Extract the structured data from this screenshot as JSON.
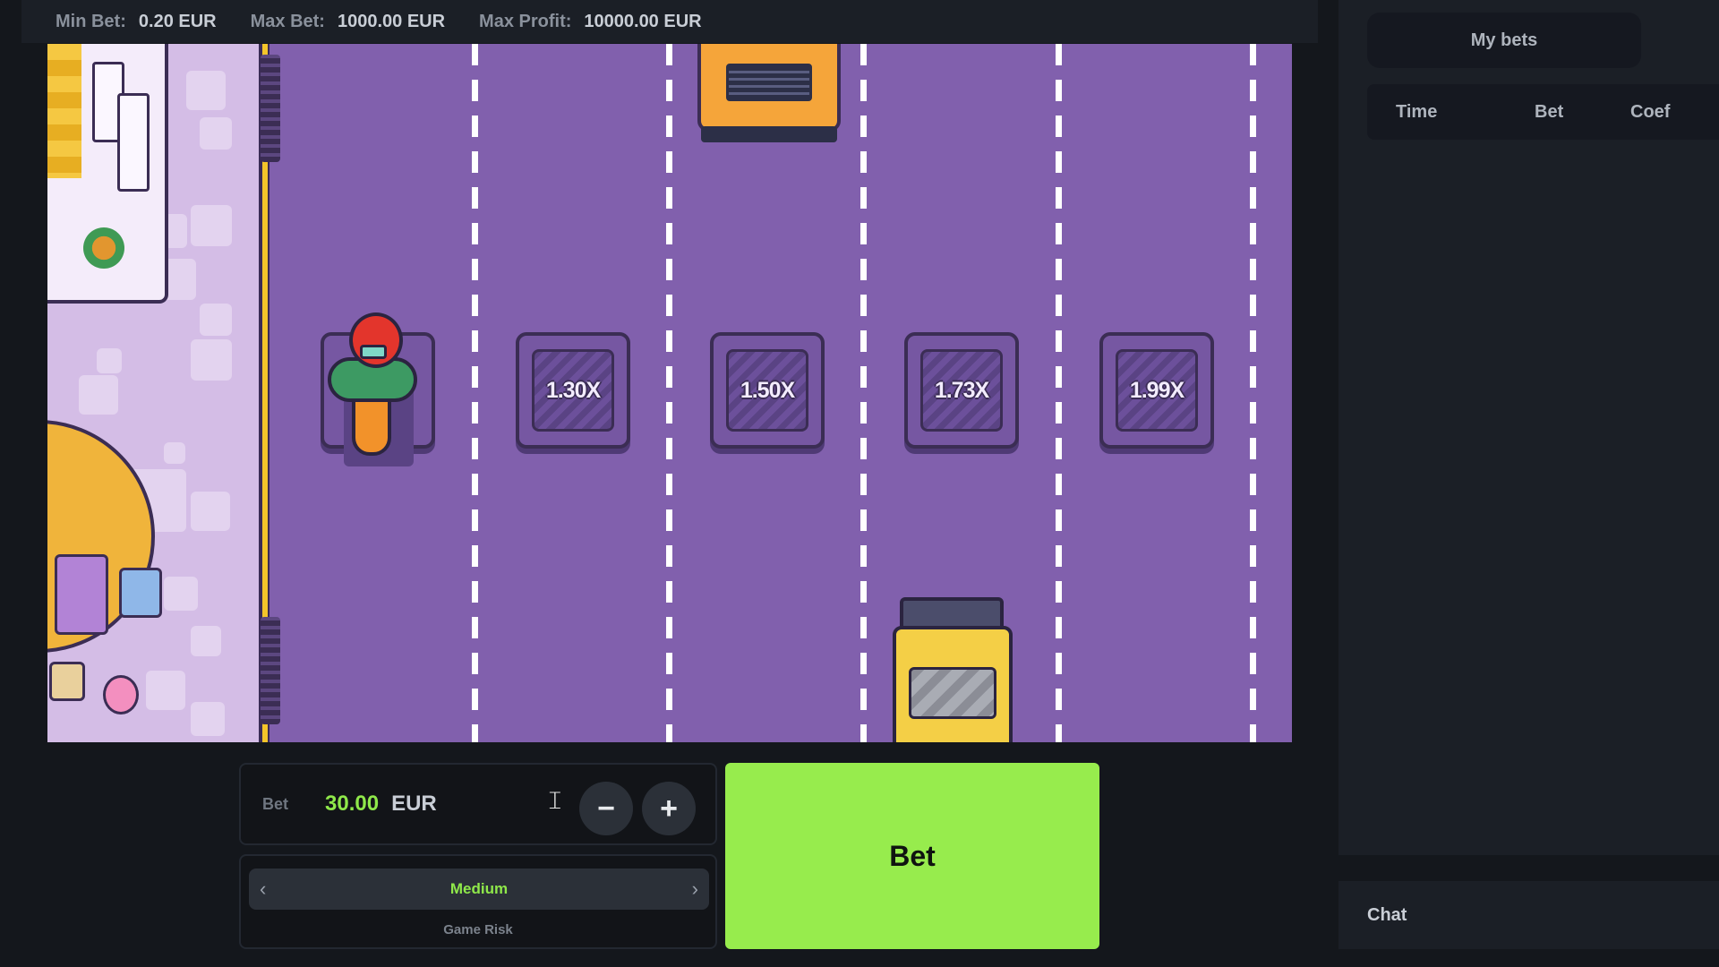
{
  "limits": {
    "min_bet_label": "Min Bet:",
    "min_bet_value": "0.20 EUR",
    "max_bet_label": "Max Bet:",
    "max_bet_value": "1000.00 EUR",
    "max_profit_label": "Max Profit:",
    "max_profit_value": "10000.00 EUR"
  },
  "game": {
    "multipliers": [
      "1.30X",
      "1.50X",
      "1.73X",
      "1.99X"
    ]
  },
  "controls": {
    "bet_label": "Bet",
    "bet_amount": "30.00",
    "bet_currency": "EUR",
    "minus_symbol": "−",
    "plus_symbol": "+",
    "risk_value": "Medium",
    "risk_caption": "Game Risk",
    "risk_prev": "‹",
    "risk_next": "›",
    "bet_button_label": "Bet"
  },
  "right_panel": {
    "tab_label": "My bets",
    "columns": [
      "Time",
      "Bet",
      "Coef"
    ],
    "chat_label": "Chat"
  },
  "colors": {
    "accent_green": "#97ec4d",
    "road_purple": "#8160ad",
    "background": "#14171c"
  }
}
